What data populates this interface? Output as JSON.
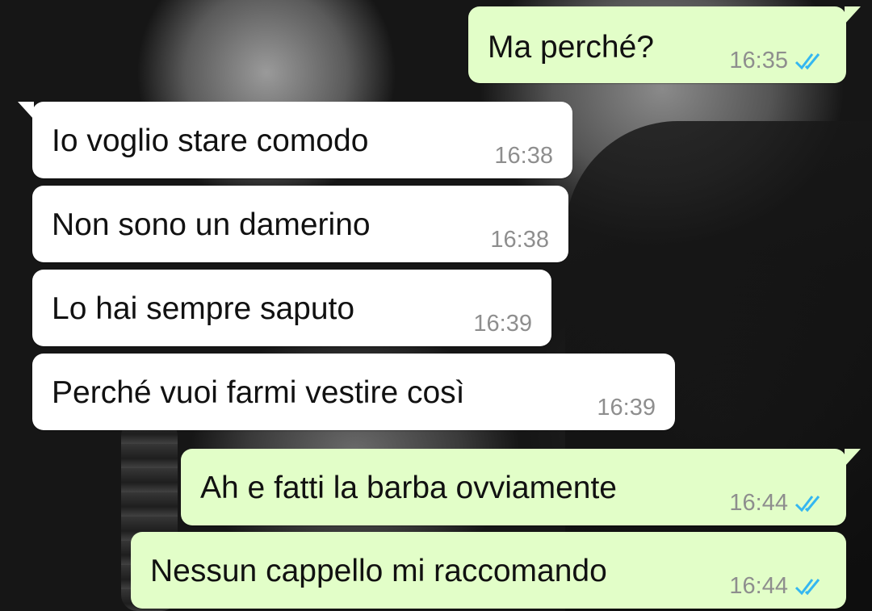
{
  "messages": [
    {
      "direction": "out",
      "text": "Ma perché?",
      "time": "16:35",
      "status_icon": "double-check-icon"
    },
    {
      "direction": "in",
      "text": "Io voglio stare comodo",
      "time": "16:38"
    },
    {
      "direction": "in",
      "text": "Non sono un damerino",
      "time": "16:38"
    },
    {
      "direction": "in",
      "text": "Lo hai sempre saputo",
      "time": "16:39"
    },
    {
      "direction": "in",
      "text": "Perché vuoi farmi vestire così",
      "time": "16:39"
    },
    {
      "direction": "out",
      "text": "Ah e fatti la barba ovviamente",
      "time": "16:44",
      "status_icon": "double-check-icon"
    },
    {
      "direction": "out",
      "text": "Nessun cappello mi raccomando",
      "time": "16:44",
      "status_icon": "double-check-icon"
    }
  ],
  "colors": {
    "incoming_bubble": "#ffffff",
    "outgoing_bubble": "#e2fec8",
    "timestamp": "#8e8e8e",
    "read_ticks": "#34b7f1"
  }
}
